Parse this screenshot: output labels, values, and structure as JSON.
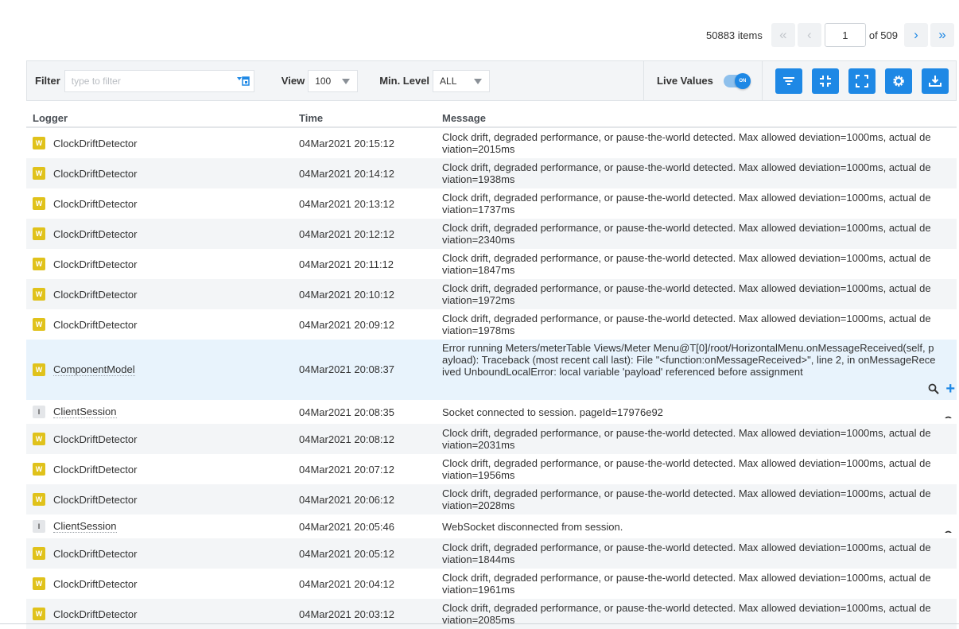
{
  "pager": {
    "items_text": "50883 items",
    "current_page": "1",
    "of_text": "of 509",
    "first_glyph": "«",
    "prev_glyph": "‹",
    "next_glyph": "›",
    "last_glyph": "»"
  },
  "toolbar": {
    "filter_label": "Filter",
    "filter_placeholder": "type to filter",
    "view_label": "View",
    "view_value": "100",
    "minlevel_label": "Min. Level",
    "minlevel_value": "ALL",
    "live_label": "Live Values",
    "live_toggle_text": "ON",
    "buttons": [
      "filter-lines-icon",
      "collapse-icon",
      "expand-icon",
      "gear-icon",
      "download-icon"
    ],
    "accent": "#1e88e5"
  },
  "table": {
    "headers": {
      "logger": "Logger",
      "time": "Time",
      "message": "Message"
    },
    "rows": [
      {
        "level": "W",
        "logger": "ClockDriftDetector",
        "time": "04Mar2021 20:15:12",
        "message": "Clock drift, degraded performance, or pause-the-world detected. Max allowed deviation=1000ms, actual deviation=2015ms"
      },
      {
        "level": "W",
        "logger": "ClockDriftDetector",
        "time": "04Mar2021 20:14:12",
        "message": "Clock drift, degraded performance, or pause-the-world detected. Max allowed deviation=1000ms, actual deviation=1938ms"
      },
      {
        "level": "W",
        "logger": "ClockDriftDetector",
        "time": "04Mar2021 20:13:12",
        "message": "Clock drift, degraded performance, or pause-the-world detected. Max allowed deviation=1000ms, actual deviation=1737ms"
      },
      {
        "level": "W",
        "logger": "ClockDriftDetector",
        "time": "04Mar2021 20:12:12",
        "message": "Clock drift, degraded performance, or pause-the-world detected. Max allowed deviation=1000ms, actual deviation=2340ms"
      },
      {
        "level": "W",
        "logger": "ClockDriftDetector",
        "time": "04Mar2021 20:11:12",
        "message": "Clock drift, degraded performance, or pause-the-world detected. Max allowed deviation=1000ms, actual deviation=1847ms"
      },
      {
        "level": "W",
        "logger": "ClockDriftDetector",
        "time": "04Mar2021 20:10:12",
        "message": "Clock drift, degraded performance, or pause-the-world detected. Max allowed deviation=1000ms, actual deviation=1972ms"
      },
      {
        "level": "W",
        "logger": "ClockDriftDetector",
        "time": "04Mar2021 20:09:12",
        "message": "Clock drift, degraded performance, or pause-the-world detected. Max allowed deviation=1000ms, actual deviation=1978ms"
      },
      {
        "level": "W",
        "logger": "ComponentModel",
        "time": "04Mar2021 20:08:37",
        "message": "Error running Meters/meterTable Views/Meter Menu@T[0]/root/HorizontalMenu.onMessageReceived(self, payload): Traceback (most recent call last): File \"<function:onMessageReceived>\", line 2, in onMessageReceived UnboundLocalError: local variable 'payload' referenced before assignment"
      },
      {
        "level": "I",
        "logger": "ClientSession",
        "time": "04Mar2021 20:08:35",
        "message": "Socket connected to session. pageId=17976e92"
      },
      {
        "level": "W",
        "logger": "ClockDriftDetector",
        "time": "04Mar2021 20:08:12",
        "message": "Clock drift, degraded performance, or pause-the-world detected. Max allowed deviation=1000ms, actual deviation=2031ms"
      },
      {
        "level": "W",
        "logger": "ClockDriftDetector",
        "time": "04Mar2021 20:07:12",
        "message": "Clock drift, degraded performance, or pause-the-world detected. Max allowed deviation=1000ms, actual deviation=1956ms"
      },
      {
        "level": "W",
        "logger": "ClockDriftDetector",
        "time": "04Mar2021 20:06:12",
        "message": "Clock drift, degraded performance, or pause-the-world detected. Max allowed deviation=1000ms, actual deviation=2028ms"
      },
      {
        "level": "I",
        "logger": "ClientSession",
        "time": "04Mar2021 20:05:46",
        "message": "WebSocket disconnected from session."
      },
      {
        "level": "W",
        "logger": "ClockDriftDetector",
        "time": "04Mar2021 20:05:12",
        "message": "Clock drift, degraded performance, or pause-the-world detected. Max allowed deviation=1000ms, actual deviation=1844ms"
      },
      {
        "level": "W",
        "logger": "ClockDriftDetector",
        "time": "04Mar2021 20:04:12",
        "message": "Clock drift, degraded performance, or pause-the-world detected. Max allowed deviation=1000ms, actual deviation=1961ms"
      },
      {
        "level": "W",
        "logger": "ClockDriftDetector",
        "time": "04Mar2021 20:03:12",
        "message": "Clock drift, degraded performance, or pause-the-world detected. Max allowed deviation=1000ms, actual deviation=2085ms"
      }
    ]
  }
}
